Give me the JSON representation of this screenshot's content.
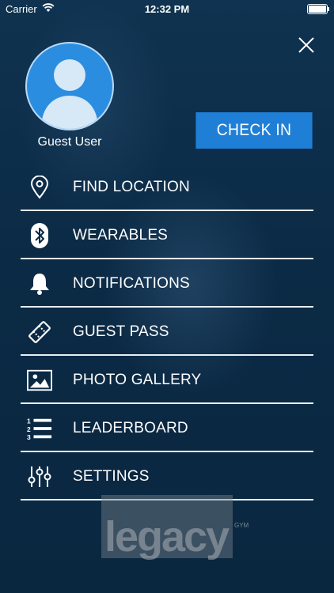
{
  "status_bar": {
    "carrier": "Carrier",
    "time": "12:32 PM"
  },
  "profile": {
    "name": "Guest User"
  },
  "check_in_label": "CHECK IN",
  "menu": [
    {
      "label": "FIND LOCATION",
      "icon": "location-pin-icon"
    },
    {
      "label": "WEARABLES",
      "icon": "bluetooth-icon"
    },
    {
      "label": "NOTIFICATIONS",
      "icon": "bell-icon"
    },
    {
      "label": "GUEST PASS",
      "icon": "ticket-icon"
    },
    {
      "label": "PHOTO GALLERY",
      "icon": "image-icon"
    },
    {
      "label": "LEADERBOARD",
      "icon": "numbered-list-icon"
    },
    {
      "label": "SETTINGS",
      "icon": "sliders-icon"
    }
  ],
  "logo": {
    "wordmark": "legacy",
    "suffix": "GYM"
  },
  "colors": {
    "accent": "#1f7fd6",
    "background": "#0b2a45",
    "divider": "#e8eef4"
  }
}
